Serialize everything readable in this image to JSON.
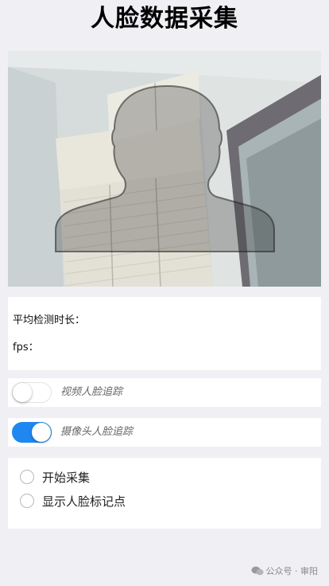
{
  "page": {
    "title": "人脸数据采集"
  },
  "camera": {
    "overlay_icon": "face-silhouette-icon"
  },
  "stats": {
    "avg_detect_label": "平均检测时长：",
    "fps_label": "fps："
  },
  "toggles": [
    {
      "label": "视频人脸追踪",
      "on": false
    },
    {
      "label": "摄像头人脸追踪",
      "on": true
    }
  ],
  "options": [
    {
      "label": "开始采集",
      "checked": false
    },
    {
      "label": "显示人脸标记点",
      "checked": false
    }
  ],
  "watermark": {
    "text": "公众号 · 审阳",
    "icon": "wechat-icon"
  },
  "colors": {
    "accent": "#1e88f0",
    "background": "#efeff4"
  }
}
